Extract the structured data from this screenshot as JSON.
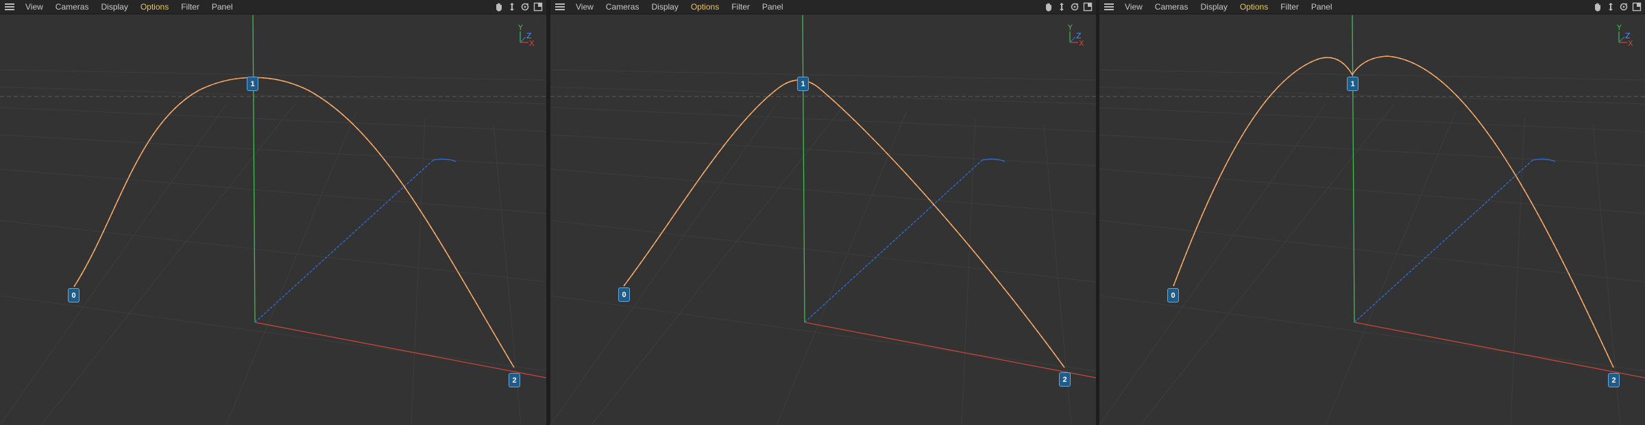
{
  "viewports": [
    {
      "menu": {
        "view": "View",
        "cameras": "Cameras",
        "display": "Display",
        "options": "Options",
        "filter": "Filter",
        "panel": "Panel"
      },
      "points": [
        "0",
        "1",
        "2"
      ],
      "gizmo": {
        "y": "Y",
        "z": "Z",
        "x": "X"
      },
      "curve_variant": "smooth-peak"
    },
    {
      "menu": {
        "view": "View",
        "cameras": "Cameras",
        "display": "Display",
        "options": "Options",
        "filter": "Filter",
        "panel": "Panel"
      },
      "points": [
        "0",
        "1",
        "2"
      ],
      "gizmo": {
        "y": "Y",
        "z": "Z",
        "x": "X"
      },
      "curve_variant": "pointed-peak"
    },
    {
      "menu": {
        "view": "View",
        "cameras": "Cameras",
        "display": "Display",
        "options": "Options",
        "filter": "Filter",
        "panel": "Panel"
      },
      "points": [
        "0",
        "1",
        "2"
      ],
      "gizmo": {
        "y": "Y",
        "z": "Z",
        "x": "X"
      },
      "curve_variant": "double-hump"
    }
  ],
  "colors": {
    "viewport_bg": "#333333",
    "menubar_bg": "#262626",
    "menu_text": "#c9c9c9",
    "menu_active": "#e7c75c",
    "spline": "#f5a25d",
    "axis_x": "#c8453a",
    "axis_y": "#3fbf4f",
    "axis_z": "#2f6fd6",
    "point_label_bg": "#1f5c8a"
  }
}
